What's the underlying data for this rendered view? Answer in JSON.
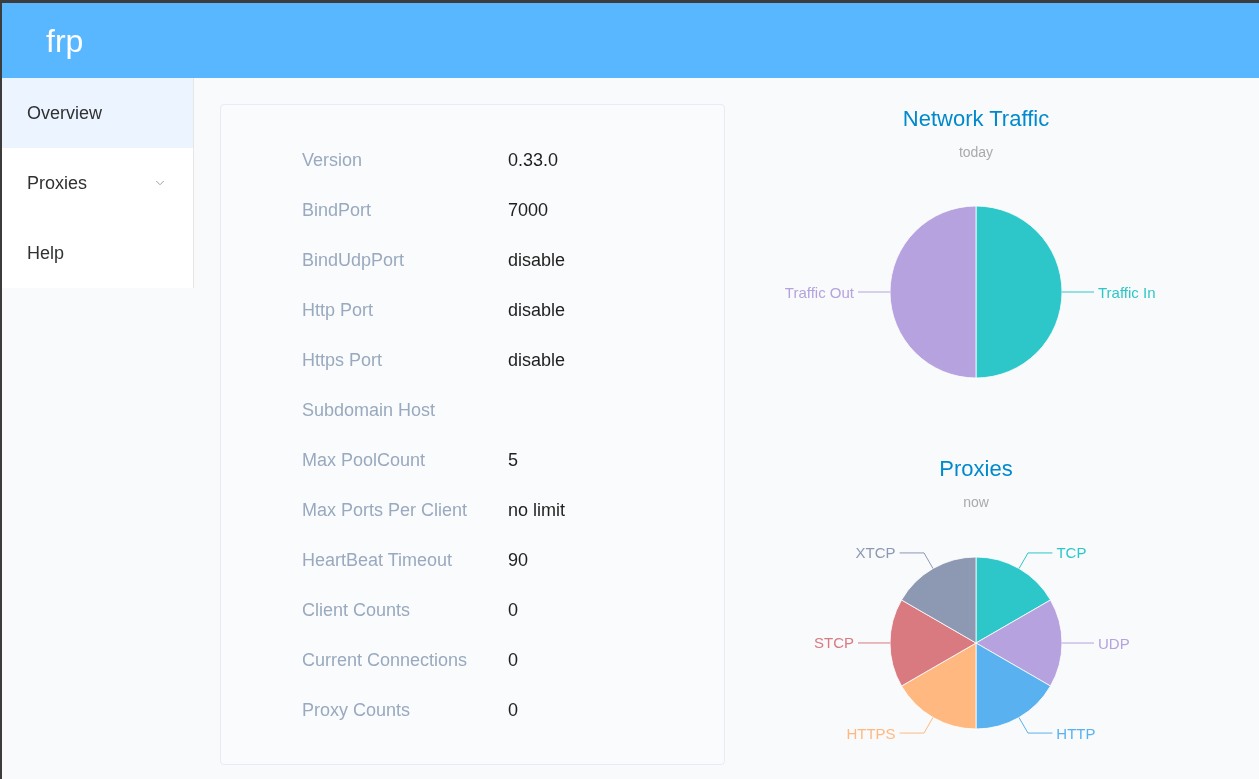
{
  "header": {
    "logo": "frp"
  },
  "sidebar": {
    "items": [
      {
        "label": "Overview",
        "kind": "link",
        "selected": true
      },
      {
        "label": "Proxies",
        "kind": "submenu",
        "selected": false,
        "expanded": false
      },
      {
        "label": "Help",
        "kind": "link",
        "selected": false
      }
    ]
  },
  "server_info": {
    "rows": [
      {
        "label": "Version",
        "value": "0.33.0"
      },
      {
        "label": "BindPort",
        "value": "7000"
      },
      {
        "label": "BindUdpPort",
        "value": "disable"
      },
      {
        "label": "Http Port",
        "value": "disable"
      },
      {
        "label": "Https Port",
        "value": "disable"
      },
      {
        "label": "Subdomain Host"
      },
      {
        "label": "Max PoolCount",
        "value": "5"
      },
      {
        "label": "Max Ports Per Client",
        "value": "no limit"
      },
      {
        "label": "HeartBeat Timeout",
        "value": "90"
      },
      {
        "label": "Client Counts",
        "value": "0"
      },
      {
        "label": "Current Connections",
        "value": "0"
      },
      {
        "label": "Proxy Counts",
        "value": "0"
      }
    ]
  },
  "charts": [
    {
      "subtitle": "today",
      "chart_data": {
        "type": "pie",
        "title": "Network Traffic",
        "categories": [
          "Traffic In",
          "Traffic Out"
        ],
        "values": [
          50,
          50
        ],
        "colors": [
          "#2ec7c9",
          "#b6a2de"
        ]
      }
    },
    {
      "subtitle": "now",
      "chart_data": {
        "type": "pie",
        "title": "Proxies",
        "categories": [
          "TCP",
          "UDP",
          "HTTP",
          "HTTPS",
          "STCP",
          "XTCP"
        ],
        "values": [
          16.67,
          16.67,
          16.66,
          16.67,
          16.67,
          16.66
        ],
        "colors": [
          "#2ec7c9",
          "#b6a2de",
          "#5ab1ef",
          "#ffb980",
          "#d87a80",
          "#8d98b3"
        ]
      }
    }
  ]
}
